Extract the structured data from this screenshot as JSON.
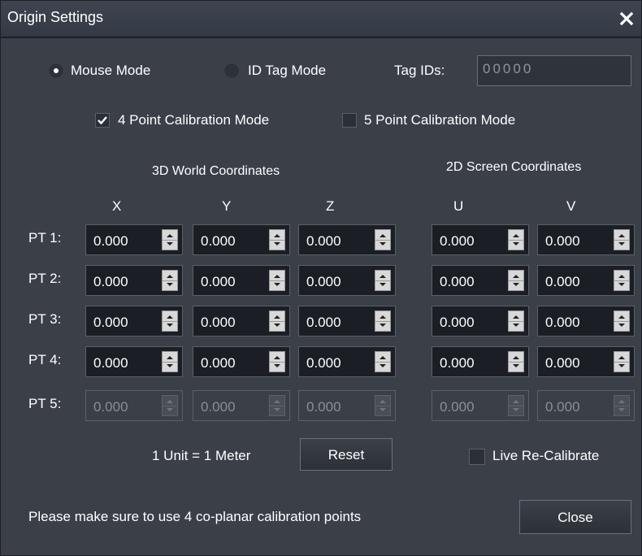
{
  "window": {
    "title": "Origin Settings",
    "close_icon": "close-icon"
  },
  "mode": {
    "mouse_mode_label": "Mouse Mode",
    "mouse_mode_selected": true,
    "id_tag_mode_label": "ID Tag Mode",
    "id_tag_mode_selected": false,
    "tag_ids_label": "Tag IDs:",
    "tag_ids_value": "00000"
  },
  "calibration": {
    "four_point_label": "4 Point Calibration Mode",
    "four_point_checked": true,
    "five_point_label": "5 Point Calibration Mode",
    "five_point_checked": false
  },
  "coords": {
    "world_heading": "3D World Coordinates",
    "screen_heading": "2D Screen Coordinates",
    "columns": [
      "X",
      "Y",
      "Z",
      "U",
      "V"
    ],
    "rows": [
      {
        "label": "PT 1:",
        "values": [
          "0.000",
          "0.000",
          "0.000",
          "0.000",
          "0.000"
        ],
        "enabled": true
      },
      {
        "label": "PT 2:",
        "values": [
          "0.000",
          "0.000",
          "0.000",
          "0.000",
          "0.000"
        ],
        "enabled": true
      },
      {
        "label": "PT 3:",
        "values": [
          "0.000",
          "0.000",
          "0.000",
          "0.000",
          "0.000"
        ],
        "enabled": true
      },
      {
        "label": "PT 4:",
        "values": [
          "0.000",
          "0.000",
          "0.000",
          "0.000",
          "0.000"
        ],
        "enabled": true
      },
      {
        "label": "PT 5:",
        "values": [
          "0.000",
          "0.000",
          "0.000",
          "0.000",
          "0.000"
        ],
        "enabled": false
      }
    ]
  },
  "footer": {
    "unit_text": "1 Unit = 1 Meter",
    "reset_label": "Reset",
    "live_recalibrate_label": "Live Re-Calibrate",
    "live_recalibrate_checked": false,
    "hint_text": "Please make sure to use 4 co-planar calibration points",
    "close_label": "Close"
  },
  "colors": {
    "background": "#3a3f48",
    "field_background": "#1b1f25",
    "text": "#ffffff",
    "disabled_text": "#8a8f96"
  }
}
